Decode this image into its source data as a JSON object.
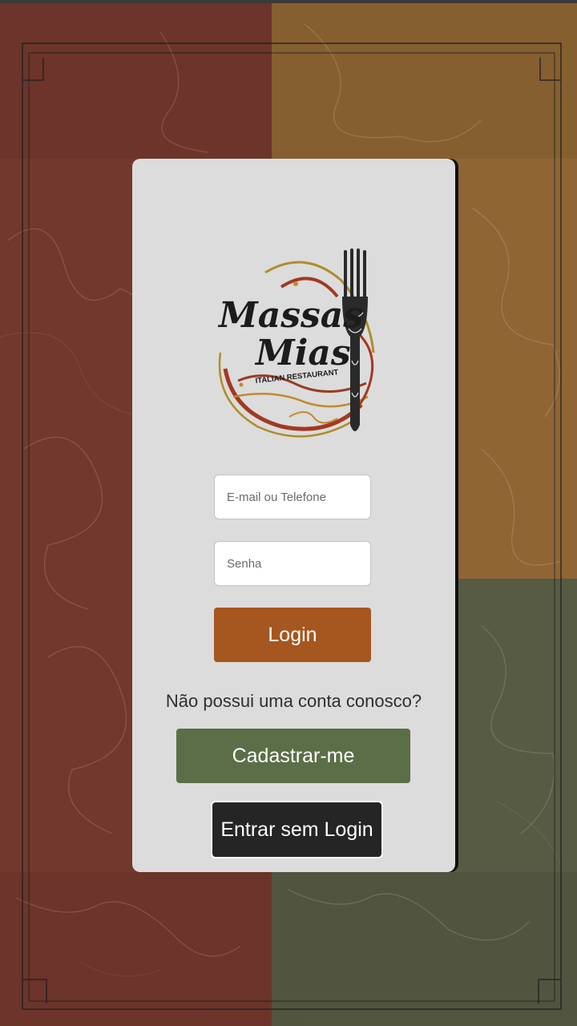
{
  "brand": {
    "line1": "Massas",
    "line2": "Mias",
    "tagline": "ITALIAN RESTAURANT"
  },
  "form": {
    "email_placeholder": "E-mail ou Telefone",
    "email_value": "",
    "password_placeholder": "Senha",
    "password_value": "",
    "login_label": "Login"
  },
  "signup": {
    "question": "Não possui uma conta conosco?",
    "signup_label": "Cadastrar-me",
    "guest_label": "Entrar sem Login"
  },
  "colors": {
    "quadrant_red": "#73382d",
    "quadrant_ochre": "#8f6534",
    "quadrant_green": "#575b44",
    "card": "#dcdcdc",
    "login_button": "#a6561f",
    "signup_button": "#5c6e47",
    "guest_button": "#252525"
  },
  "icons": {
    "logo_fork": "fork-icon"
  }
}
